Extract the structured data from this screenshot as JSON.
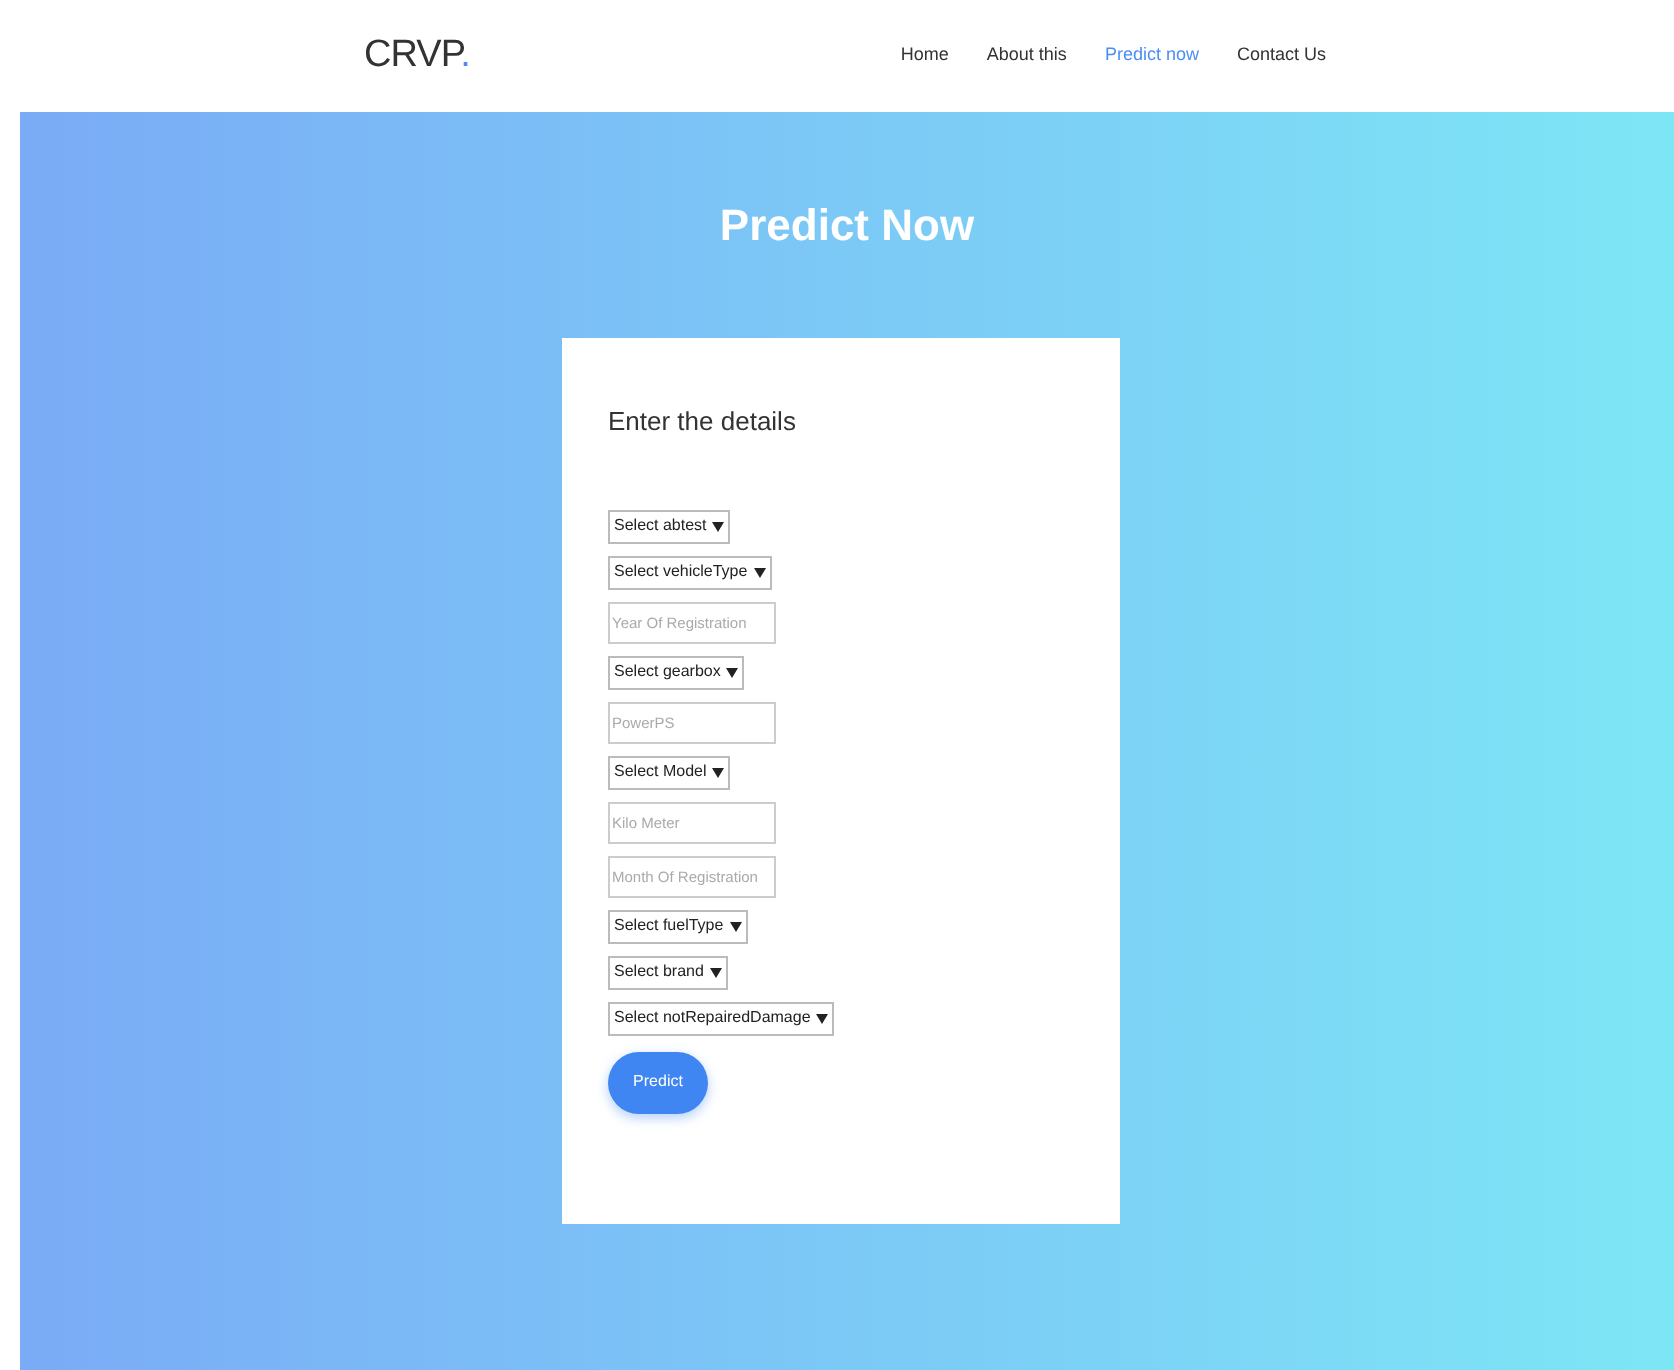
{
  "logo": {
    "text": "CRVP",
    "mark": "."
  },
  "nav": [
    {
      "label": "Home",
      "selected": false
    },
    {
      "label": "About this",
      "selected": false
    },
    {
      "label": "Predict now",
      "selected": true
    },
    {
      "label": "Contact Us",
      "selected": false
    }
  ],
  "heading": "Predict Now",
  "form": {
    "title": "Enter the details",
    "fields": [
      {
        "kind": "select",
        "value": "Select abtest"
      },
      {
        "kind": "select",
        "value": "Select vehicleType"
      },
      {
        "kind": "input",
        "placeholder": "Year Of Registration"
      },
      {
        "kind": "select",
        "value": "Select gearbox"
      },
      {
        "kind": "input",
        "placeholder": "PowerPS"
      },
      {
        "kind": "select",
        "value": "Select Model"
      },
      {
        "kind": "input",
        "placeholder": "Kilo Meter"
      },
      {
        "kind": "input",
        "placeholder": "Month Of Registration"
      },
      {
        "kind": "select",
        "value": "Select fuelType"
      },
      {
        "kind": "select",
        "value": "Select brand"
      },
      {
        "kind": "select",
        "value": "Select notRepairedDamage"
      }
    ],
    "button": "Predict"
  }
}
